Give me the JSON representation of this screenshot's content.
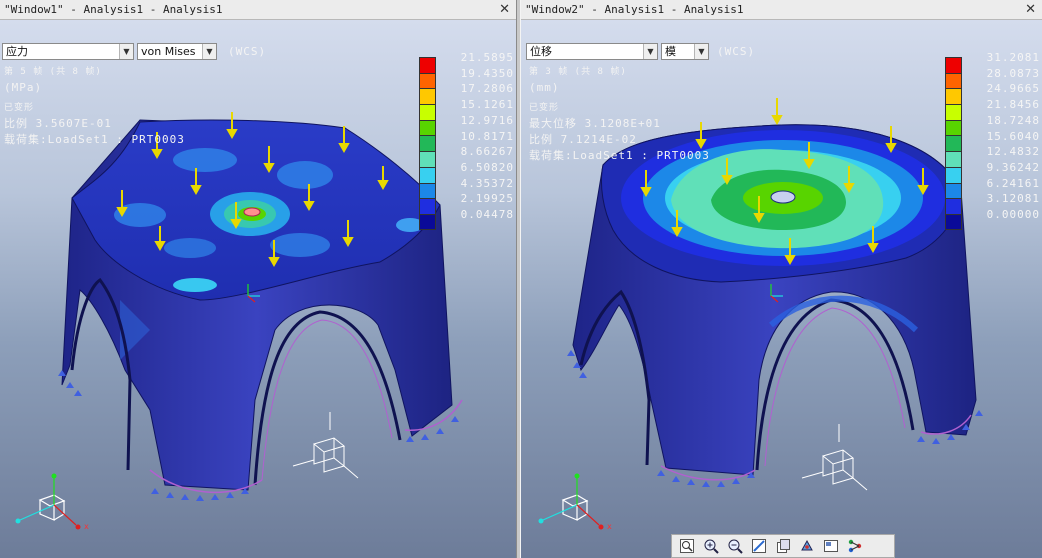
{
  "left_window": {
    "title": "\"Window1\" - Analysis1 - Analysis1",
    "quantity_select": "应力",
    "component_select": "von Mises",
    "csys_label": "(WCS)",
    "info_lines": [
      "第 5 帧 (共 8 帧)",
      "(MPa)",
      "已变形",
      "比例  3.5607E-01",
      "载荷集:LoadSet1 : PRT0003"
    ],
    "legend_values": [
      "21.5895",
      "19.4350",
      "17.2806",
      "15.1261",
      "12.9716",
      "10.8171",
      "8.66267",
      "6.50820",
      "4.35372",
      "2.19925",
      "0.04478"
    ]
  },
  "right_window": {
    "title": "\"Window2\" - Analysis1 - Analysis1",
    "quantity_select": "位移",
    "component_select": "模",
    "csys_label": "(WCS)",
    "info_lines": [
      "第 3 帧 (共 8 帧)",
      "(mm)",
      "已变形",
      "最大位移  3.1208E+01",
      "比例  7.1214E-02",
      "载荷集:LoadSet1 : PRT0003"
    ],
    "legend_values": [
      "31.2081",
      "28.0873",
      "24.9665",
      "21.8456",
      "18.7248",
      "15.6040",
      "12.4832",
      "9.36242",
      "6.24161",
      "3.12081",
      "0.00000"
    ]
  },
  "legend_colors": [
    "#ee0000",
    "#ff6400",
    "#ffc800",
    "#c8ff00",
    "#58d400",
    "#22b858",
    "#60e0b8",
    "#38d0f0",
    "#1c88e8",
    "#1f2ee0",
    "#0a0a98"
  ],
  "toolbar_icons": [
    "refit-icon",
    "zoom-in-icon",
    "zoom-out-icon",
    "repaint-icon",
    "view-manager-icon",
    "spin-center-icon",
    "saved-views-icon",
    "model-tree-icon"
  ]
}
